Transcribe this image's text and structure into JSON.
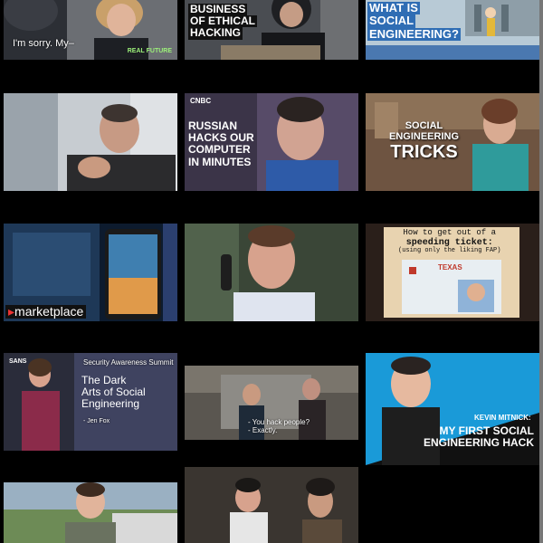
{
  "thumbs": {
    "t1": {
      "caption": "I'm sorry. My–",
      "brand": "REAL FUTURE"
    },
    "t2": {
      "line1": "BUSINESS",
      "line2": "OF ETHICAL",
      "line3": "HACKING"
    },
    "t3": {
      "line1": "WHAT IS",
      "line2": "SOCIAL",
      "line3": "ENGINEERING?"
    },
    "t4": {},
    "t5": {
      "logo": "CNBC",
      "line1": "RUSSIAN",
      "line2": "HACKS OUR",
      "line3": "COMPUTER",
      "line4": "IN MINUTES"
    },
    "t6": {
      "line1": "SOCIAL",
      "line2": "ENGINEERING",
      "line3": "TRICKS"
    },
    "t7": {
      "brand": "marketplace"
    },
    "t8": {},
    "t9": {
      "line1": "How to get out of a",
      "line2": "speeding ticket:",
      "line3": "(using only the liking FAP)",
      "state": "TEXAS"
    },
    "t10": {
      "org": "SANS",
      "event": "Security Awareness Summit",
      "line1": "The Dark",
      "line2": "Arts of Social",
      "line3": "Engineering",
      "speaker": "- Jen Fox"
    },
    "t11": {
      "caption1": "- You hack people?",
      "caption2": "- Exactly."
    },
    "t12": {
      "name": "KEVIN MITNICK:",
      "line1": "MY FIRST SOCIAL",
      "line2": "ENGINEERING HACK"
    },
    "t13": {},
    "t14": {}
  }
}
